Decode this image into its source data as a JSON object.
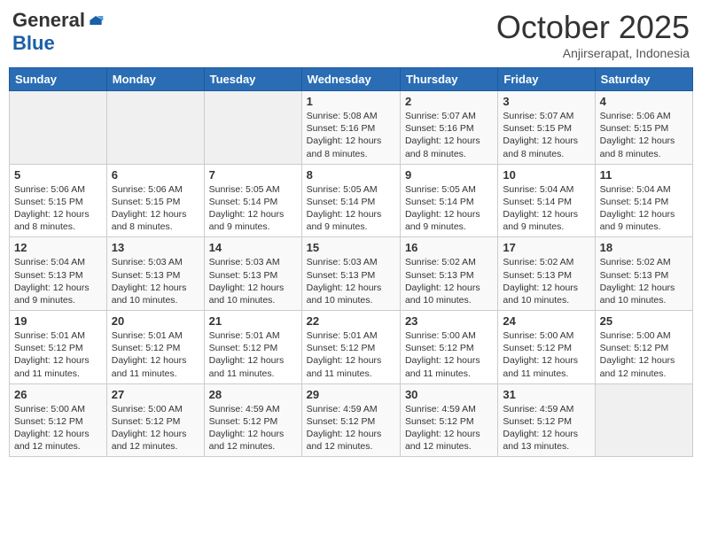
{
  "logo": {
    "general": "General",
    "blue": "Blue"
  },
  "header": {
    "month": "October 2025",
    "location": "Anjirserapat, Indonesia"
  },
  "weekdays": [
    "Sunday",
    "Monday",
    "Tuesday",
    "Wednesday",
    "Thursday",
    "Friday",
    "Saturday"
  ],
  "weeks": [
    [
      {
        "day": "",
        "info": ""
      },
      {
        "day": "",
        "info": ""
      },
      {
        "day": "",
        "info": ""
      },
      {
        "day": "1",
        "info": "Sunrise: 5:08 AM\nSunset: 5:16 PM\nDaylight: 12 hours\nand 8 minutes."
      },
      {
        "day": "2",
        "info": "Sunrise: 5:07 AM\nSunset: 5:16 PM\nDaylight: 12 hours\nand 8 minutes."
      },
      {
        "day": "3",
        "info": "Sunrise: 5:07 AM\nSunset: 5:15 PM\nDaylight: 12 hours\nand 8 minutes."
      },
      {
        "day": "4",
        "info": "Sunrise: 5:06 AM\nSunset: 5:15 PM\nDaylight: 12 hours\nand 8 minutes."
      }
    ],
    [
      {
        "day": "5",
        "info": "Sunrise: 5:06 AM\nSunset: 5:15 PM\nDaylight: 12 hours\nand 8 minutes."
      },
      {
        "day": "6",
        "info": "Sunrise: 5:06 AM\nSunset: 5:15 PM\nDaylight: 12 hours\nand 8 minutes."
      },
      {
        "day": "7",
        "info": "Sunrise: 5:05 AM\nSunset: 5:14 PM\nDaylight: 12 hours\nand 9 minutes."
      },
      {
        "day": "8",
        "info": "Sunrise: 5:05 AM\nSunset: 5:14 PM\nDaylight: 12 hours\nand 9 minutes."
      },
      {
        "day": "9",
        "info": "Sunrise: 5:05 AM\nSunset: 5:14 PM\nDaylight: 12 hours\nand 9 minutes."
      },
      {
        "day": "10",
        "info": "Sunrise: 5:04 AM\nSunset: 5:14 PM\nDaylight: 12 hours\nand 9 minutes."
      },
      {
        "day": "11",
        "info": "Sunrise: 5:04 AM\nSunset: 5:14 PM\nDaylight: 12 hours\nand 9 minutes."
      }
    ],
    [
      {
        "day": "12",
        "info": "Sunrise: 5:04 AM\nSunset: 5:13 PM\nDaylight: 12 hours\nand 9 minutes."
      },
      {
        "day": "13",
        "info": "Sunrise: 5:03 AM\nSunset: 5:13 PM\nDaylight: 12 hours\nand 10 minutes."
      },
      {
        "day": "14",
        "info": "Sunrise: 5:03 AM\nSunset: 5:13 PM\nDaylight: 12 hours\nand 10 minutes."
      },
      {
        "day": "15",
        "info": "Sunrise: 5:03 AM\nSunset: 5:13 PM\nDaylight: 12 hours\nand 10 minutes."
      },
      {
        "day": "16",
        "info": "Sunrise: 5:02 AM\nSunset: 5:13 PM\nDaylight: 12 hours\nand 10 minutes."
      },
      {
        "day": "17",
        "info": "Sunrise: 5:02 AM\nSunset: 5:13 PM\nDaylight: 12 hours\nand 10 minutes."
      },
      {
        "day": "18",
        "info": "Sunrise: 5:02 AM\nSunset: 5:13 PM\nDaylight: 12 hours\nand 10 minutes."
      }
    ],
    [
      {
        "day": "19",
        "info": "Sunrise: 5:01 AM\nSunset: 5:12 PM\nDaylight: 12 hours\nand 11 minutes."
      },
      {
        "day": "20",
        "info": "Sunrise: 5:01 AM\nSunset: 5:12 PM\nDaylight: 12 hours\nand 11 minutes."
      },
      {
        "day": "21",
        "info": "Sunrise: 5:01 AM\nSunset: 5:12 PM\nDaylight: 12 hours\nand 11 minutes."
      },
      {
        "day": "22",
        "info": "Sunrise: 5:01 AM\nSunset: 5:12 PM\nDaylight: 12 hours\nand 11 minutes."
      },
      {
        "day": "23",
        "info": "Sunrise: 5:00 AM\nSunset: 5:12 PM\nDaylight: 12 hours\nand 11 minutes."
      },
      {
        "day": "24",
        "info": "Sunrise: 5:00 AM\nSunset: 5:12 PM\nDaylight: 12 hours\nand 11 minutes."
      },
      {
        "day": "25",
        "info": "Sunrise: 5:00 AM\nSunset: 5:12 PM\nDaylight: 12 hours\nand 12 minutes."
      }
    ],
    [
      {
        "day": "26",
        "info": "Sunrise: 5:00 AM\nSunset: 5:12 PM\nDaylight: 12 hours\nand 12 minutes."
      },
      {
        "day": "27",
        "info": "Sunrise: 5:00 AM\nSunset: 5:12 PM\nDaylight: 12 hours\nand 12 minutes."
      },
      {
        "day": "28",
        "info": "Sunrise: 4:59 AM\nSunset: 5:12 PM\nDaylight: 12 hours\nand 12 minutes."
      },
      {
        "day": "29",
        "info": "Sunrise: 4:59 AM\nSunset: 5:12 PM\nDaylight: 12 hours\nand 12 minutes."
      },
      {
        "day": "30",
        "info": "Sunrise: 4:59 AM\nSunset: 5:12 PM\nDaylight: 12 hours\nand 12 minutes."
      },
      {
        "day": "31",
        "info": "Sunrise: 4:59 AM\nSunset: 5:12 PM\nDaylight: 12 hours\nand 13 minutes."
      },
      {
        "day": "",
        "info": ""
      }
    ]
  ]
}
